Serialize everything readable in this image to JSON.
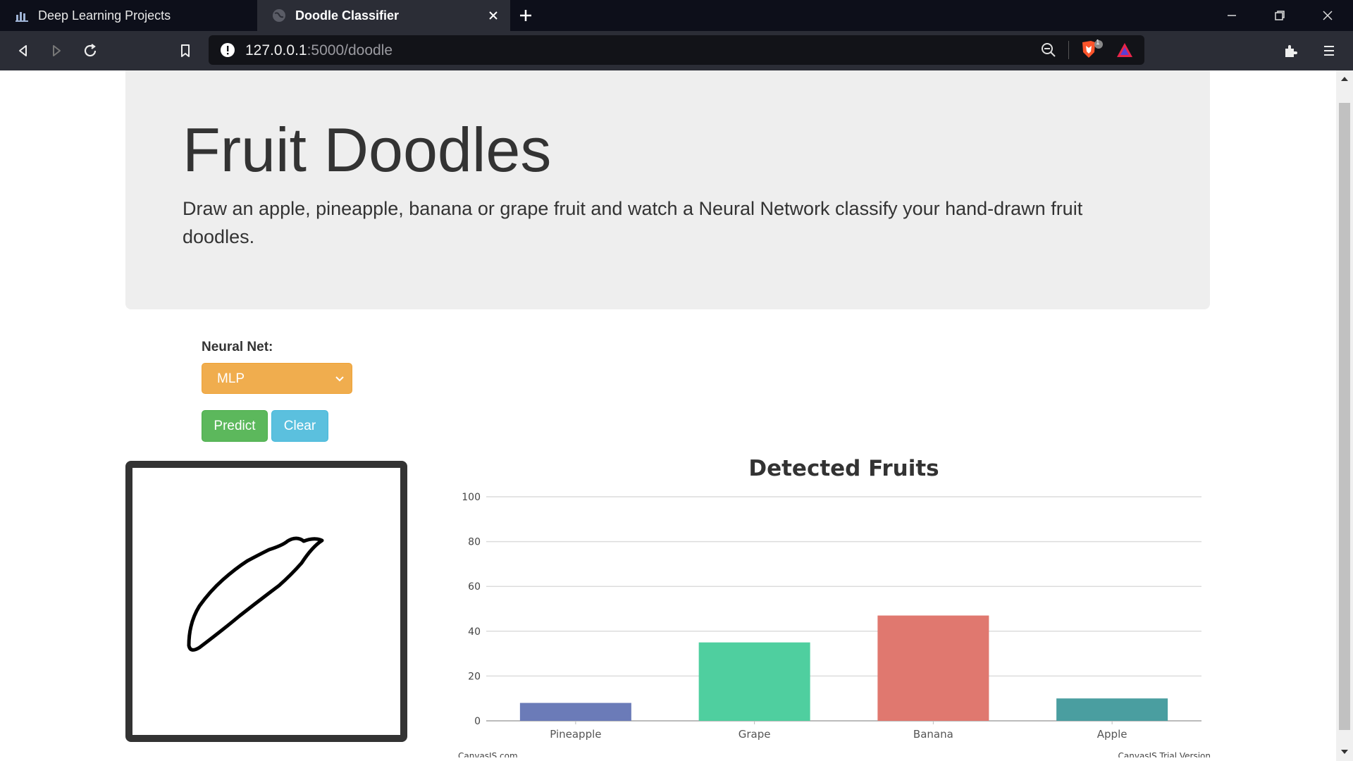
{
  "browser": {
    "tabs": [
      {
        "label": "Deep Learning Projects",
        "active": false
      },
      {
        "label": "Doodle Classifier",
        "active": true
      }
    ],
    "url_host": "127.0.0.1",
    "url_rest": ":5000/doodle",
    "shields_count": "1"
  },
  "header": {
    "title": "Fruit Doodles",
    "lead": "Draw an apple, pineapple, banana or grape fruit and watch a Neural Network classify your hand-drawn fruit doodles."
  },
  "controls": {
    "nn_label": "Neural Net:",
    "nn_selected": "MLP",
    "predict_label": "Predict",
    "clear_label": "Clear"
  },
  "chart_data": {
    "type": "bar",
    "title": "Detected Fruits",
    "categories": [
      "Pineapple",
      "Grape",
      "Banana",
      "Apple"
    ],
    "values": [
      8,
      35,
      47,
      10
    ],
    "colors": [
      "#6b7bb8",
      "#4fcf9f",
      "#e0786f",
      "#4a9ea0"
    ],
    "ylim": [
      0,
      100
    ],
    "yticks": [
      0,
      20,
      40,
      60,
      80,
      100
    ],
    "credit_left": "CanvasJS.com",
    "credit_right": "CanvasJS Trial Version"
  }
}
